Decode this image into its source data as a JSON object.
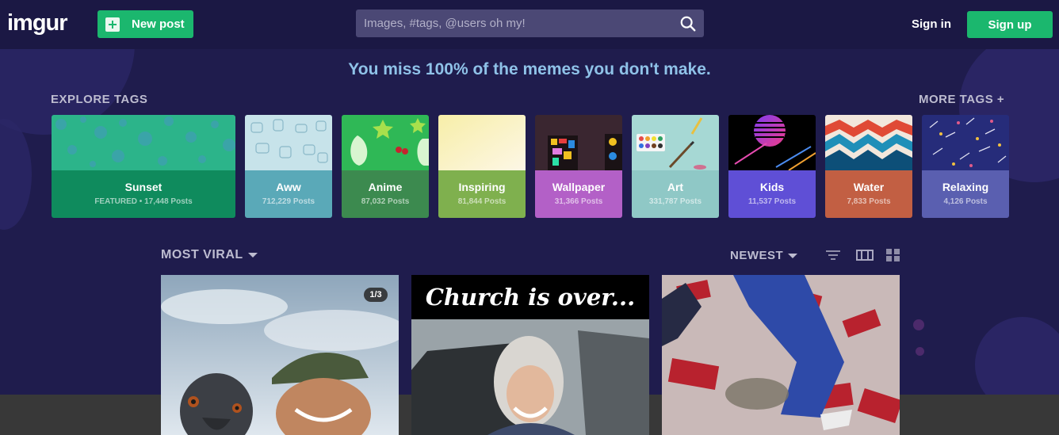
{
  "header": {
    "logo": "imgur",
    "new_post_label": "New post",
    "search_placeholder": "Images, #tags, @users oh my!",
    "sign_in": "Sign in",
    "sign_up": "Sign up"
  },
  "tagline": "You miss 100% of the memes you don't make.",
  "explore": {
    "title": "EXPLORE TAGS",
    "more": "MORE TAGS +",
    "tags": [
      {
        "name": "Sunset",
        "meta": "FEATURED • 17,448 Posts",
        "color": "#0f8b5d"
      },
      {
        "name": "Aww",
        "meta": "712,229 Posts",
        "color": "#5aa9b8"
      },
      {
        "name": "Anime",
        "meta": "87,032 Posts",
        "color": "#3c8a4f"
      },
      {
        "name": "Inspiring",
        "meta": "81,844 Posts",
        "color": "#7fb04e"
      },
      {
        "name": "Wallpaper",
        "meta": "31,366 Posts",
        "color": "#b360c7"
      },
      {
        "name": "Art",
        "meta": "331,787 Posts",
        "color": "#8fc8c6"
      },
      {
        "name": "Kids",
        "meta": "11,537 Posts",
        "color": "#5f4fd6"
      },
      {
        "name": "Water",
        "meta": "7,833 Posts",
        "color": "#c25f43"
      },
      {
        "name": "Relaxing",
        "meta": "4,126 Posts",
        "color": "#5a5fb0"
      }
    ]
  },
  "feed": {
    "sort_label": "MOST VIRAL",
    "order_label": "NEWEST",
    "posts": [
      {
        "badge": "1/3"
      },
      {
        "caption": "Church is over..."
      },
      {}
    ]
  }
}
